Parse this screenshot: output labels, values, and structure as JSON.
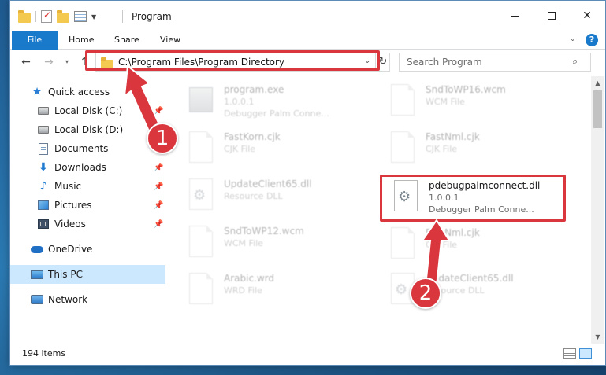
{
  "window": {
    "title": "Program",
    "minimize_glyph": "",
    "close_glyph": "✕"
  },
  "ribbon": {
    "tabs": [
      {
        "label": "File"
      },
      {
        "label": "Home"
      },
      {
        "label": "Share"
      },
      {
        "label": "View"
      }
    ],
    "help_glyph": "?"
  },
  "navigation": {
    "back_glyph": "←",
    "forward_glyph": "→",
    "recent_glyph": "▾",
    "up_glyph": "↑",
    "address": "C:\\Program Files\\Program Directory",
    "refresh_glyph": "↻",
    "search_placeholder": "Search Program"
  },
  "sidebar": {
    "items": [
      {
        "label": "Quick access",
        "icon": "star-icon",
        "pinned": false
      },
      {
        "label": "Local Disk (C:)",
        "icon": "disk-icon",
        "pinned": true
      },
      {
        "label": "Local Disk (D:)",
        "icon": "disk-icon",
        "pinned": false
      },
      {
        "label": "Documents",
        "icon": "documents-icon",
        "pinned": false
      },
      {
        "label": "Downloads",
        "icon": "downloads-icon",
        "pinned": true
      },
      {
        "label": "Music",
        "icon": "music-icon",
        "pinned": true
      },
      {
        "label": "Pictures",
        "icon": "pictures-icon",
        "pinned": true
      },
      {
        "label": "Videos",
        "icon": "videos-icon",
        "pinned": true
      },
      {
        "label": "OneDrive",
        "icon": "cloud-icon",
        "pinned": false
      },
      {
        "label": "This PC",
        "icon": "computer-icon",
        "pinned": false,
        "selected": true
      },
      {
        "label": "Network",
        "icon": "network-icon",
        "pinned": false
      }
    ]
  },
  "files": [
    {
      "name": "program.exe",
      "line2": "1.0.0.1",
      "line3": "Debugger Palm Conne...",
      "thumb": "exe"
    },
    {
      "name": "SndToWP16.wcm",
      "line2": "WCM File",
      "line3": "",
      "thumb": "doc"
    },
    {
      "name": "FastKorn.cjk",
      "line2": "CJK File",
      "line3": "",
      "thumb": "doc"
    },
    {
      "name": "FastNml.cjk",
      "line2": "CJK File",
      "line3": "",
      "thumb": "doc"
    },
    {
      "name": "UpdateClient65.dll",
      "line2": "Resource DLL",
      "line3": "",
      "thumb": "gear"
    },
    {
      "name": "pdebugpalmconnect.dll",
      "line2": "1.0.0.1",
      "line3": "Debugger Palm Conne...",
      "thumb": "gear"
    },
    {
      "name": "SndToWP12.wcm",
      "line2": "WCM File",
      "line3": "",
      "thumb": "doc"
    },
    {
      "name": "FastNml.cjk",
      "line2": "CJK File",
      "line3": "",
      "thumb": "doc"
    },
    {
      "name": "Arabic.wrd",
      "line2": "WRD File",
      "line3": "",
      "thumb": "doc"
    },
    {
      "name": "UpdateClient65.dll",
      "line2": "Resource DLL",
      "line3": "",
      "thumb": "gear"
    }
  ],
  "status": {
    "item_count": "194 items"
  },
  "scrollbar": {
    "up_glyph": "▲",
    "down_glyph": "▼"
  },
  "callouts": [
    {
      "number": "1"
    },
    {
      "number": "2"
    }
  ],
  "colors": {
    "accent": "#1979ca",
    "callout": "#d9363e",
    "selection": "#cce8ff"
  }
}
